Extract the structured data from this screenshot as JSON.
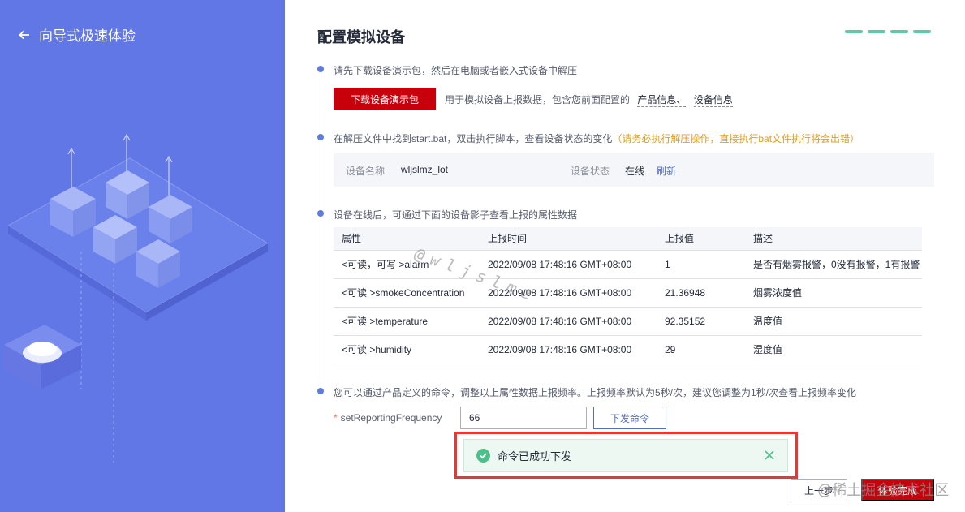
{
  "sidebar": {
    "back_label": "向导式极速体验"
  },
  "header": {
    "title": "配置模拟设备"
  },
  "steps": {
    "step1_text": "请先下载设备演示包，然后在电脑或者嵌入式设备中解压",
    "download_button": "下载设备演示包",
    "step1_desc": "用于模拟设备上报数据，包含您前面配置的",
    "link_product": "产品信息、",
    "link_device": "设备信息",
    "step2_text": "在解压文件中找到start.bat，双击执行脚本，查看设备状态的变化",
    "step2_warning": "（请务必执行解压操作，直接执行bat文件执行将会出错）",
    "step3_text": "设备在线后，可通过下面的设备影子查看上报的属性数据",
    "step4_text": "您可以通过产品定义的命令，调整以上属性数据上报频率。上报频率默认为5秒/次，建议您调整为1秒/次查看上报频率变化"
  },
  "device": {
    "name_label": "设备名称",
    "name_value": "wljslmz_lot",
    "status_label": "设备状态",
    "status_value": "在线",
    "refresh_label": "刷新"
  },
  "table": {
    "headers": [
      "属性",
      "上报时间",
      "上报值",
      "描述"
    ],
    "rows": [
      {
        "attr": "<可读，可写 >alarm",
        "time": "2022/09/08 17:48:16 GMT+08:00",
        "value": "1",
        "desc": "是否有烟雾报警，0没有报警，1有报警"
      },
      {
        "attr": "<可读 >smokeConcentration",
        "time": "2022/09/08 17:48:16 GMT+08:00",
        "value": "21.36948",
        "desc": "烟雾浓度值"
      },
      {
        "attr": "<可读 >temperature",
        "time": "2022/09/08 17:48:16 GMT+08:00",
        "value": "92.35152",
        "desc": "温度值"
      },
      {
        "attr": "<可读 >humidity",
        "time": "2022/09/08 17:48:16 GMT+08:00",
        "value": "29",
        "desc": "湿度值"
      }
    ]
  },
  "command": {
    "required_mark": "*",
    "label": "setReportingFrequency",
    "input_value": "66",
    "send_button": "下发命令"
  },
  "toast": {
    "message": "命令已成功下发"
  },
  "footer": {
    "prev_button": "上一步",
    "done_button": "体验完成"
  },
  "watermarks": {
    "diagonal": "@wljslmz",
    "corner": "@稀土掘金技术社区"
  },
  "colors": {
    "sidebar_bg": "#6277e6",
    "primary_red": "#c7000b",
    "link_blue": "#526ecc",
    "step_dot": "#5e7ce0",
    "warning": "#e39d18",
    "success": "#4cc08a",
    "highlight_frame": "#e53935"
  }
}
